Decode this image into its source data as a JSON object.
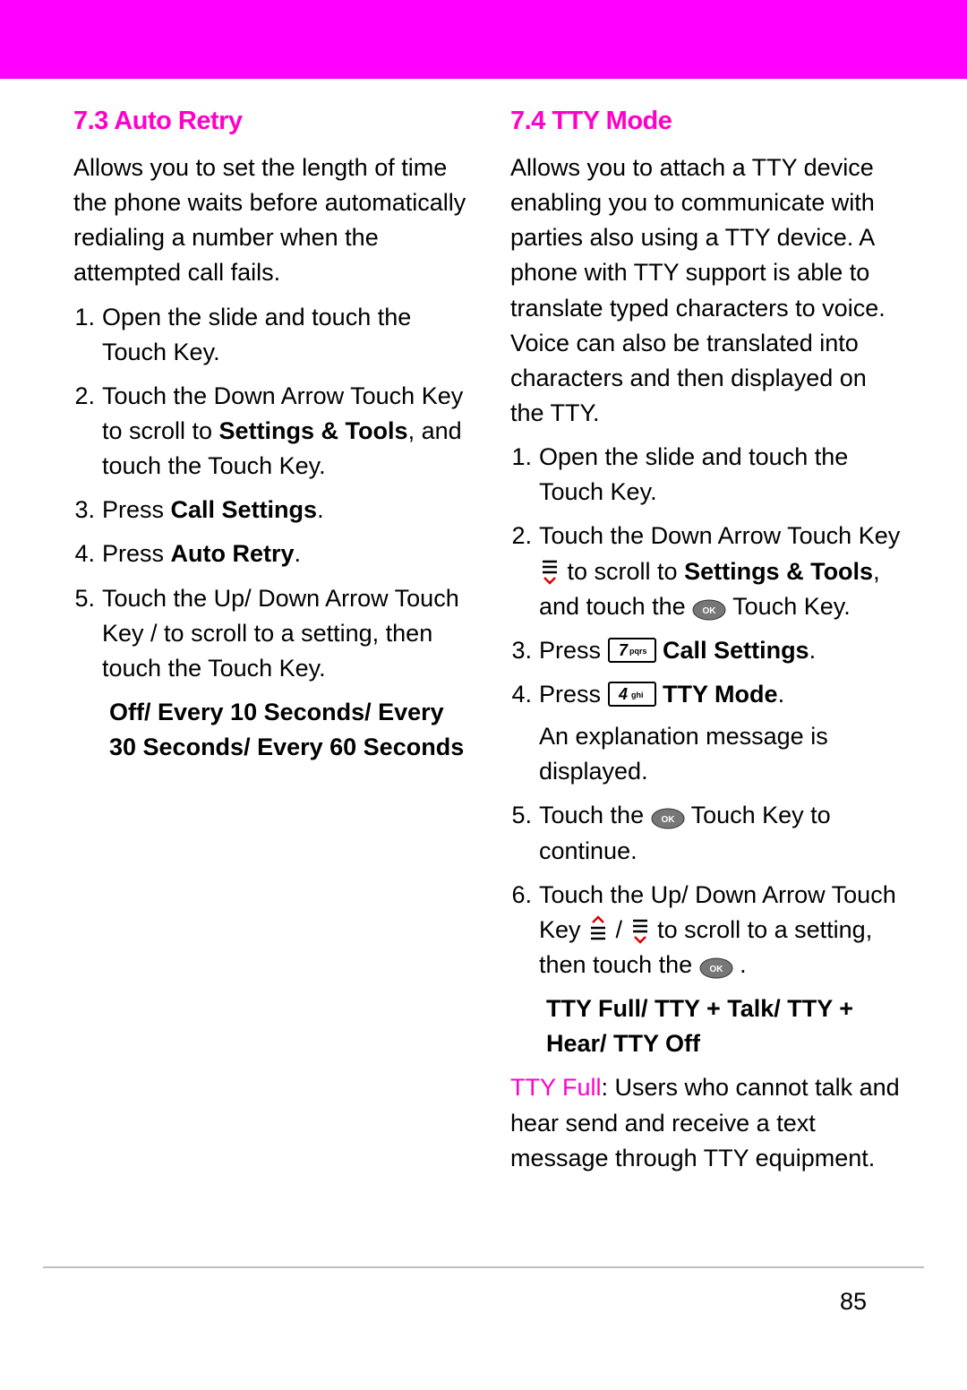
{
  "page_number": "85",
  "left": {
    "heading": "7.3 Auto Retry",
    "intro": "Allows you to set the length of time the phone waits before automatically redialing a number when the attempted call fails.",
    "steps": {
      "s1": "Open the slide and touch the Touch Key.",
      "s2a": "Touch the Down Arrow Touch Key ",
      "s2b": " to scroll to ",
      "s2bold": "Settings & Tools",
      "s2c": ", and touch the ",
      "s2d": " Touch Key.",
      "s3a": "Press ",
      "s3bold": "Call Settings",
      "s3b": ".",
      "s4a": "Press ",
      "s4bold": "Auto Retry",
      "s4b": ".",
      "s5a": "Touch the Up/ Down Arrow Touch Key ",
      "s5b": " / ",
      "s5c": " to scroll to a setting, then touch the ",
      "s5d": " Touch Key."
    },
    "options": "Off/ Every 10 Seconds/ Every 30 Seconds/ Every 60 Seconds"
  },
  "right": {
    "heading": "7.4 TTY Mode",
    "intro": "Allows you to attach a TTY device enabling you to communicate with parties also using a TTY device. A phone with TTY support is able to translate typed characters to voice. Voice can also be translated into characters and then displayed on the TTY.",
    "steps": {
      "s1": "Open the slide and touch the Touch Key.",
      "s2a": "Touch the Down Arrow Touch Key ",
      "s2b": " to scroll to ",
      "s2bold": "Settings & Tools",
      "s2c": ", and touch the ",
      "s2d": " Touch Key.",
      "s3a": "Press ",
      "s3bold": "Call Settings",
      "s3b": ".",
      "s4a": "Press ",
      "s4bold": "TTY Mode",
      "s4b": ".",
      "s4note": "An explanation message is displayed.",
      "s5a": "Touch the ",
      "s5b": " Touch Key to continue.",
      "s6a": "Touch the Up/ Down Arrow Touch Key ",
      "s6b": " / ",
      "s6c": " to scroll to a setting, then touch the ",
      "s6d": "."
    },
    "options": "TTY Full/ TTY + Talk/ TTY + Hear/ TTY Off",
    "tty_full_label": "TTY Full",
    "tty_full_text": ": Users who cannot  talk and hear send and receive a text message through TTY equipment."
  },
  "key_labels": {
    "seven": "7pqrs",
    "four": "4 ghi",
    "ok": "OK"
  }
}
